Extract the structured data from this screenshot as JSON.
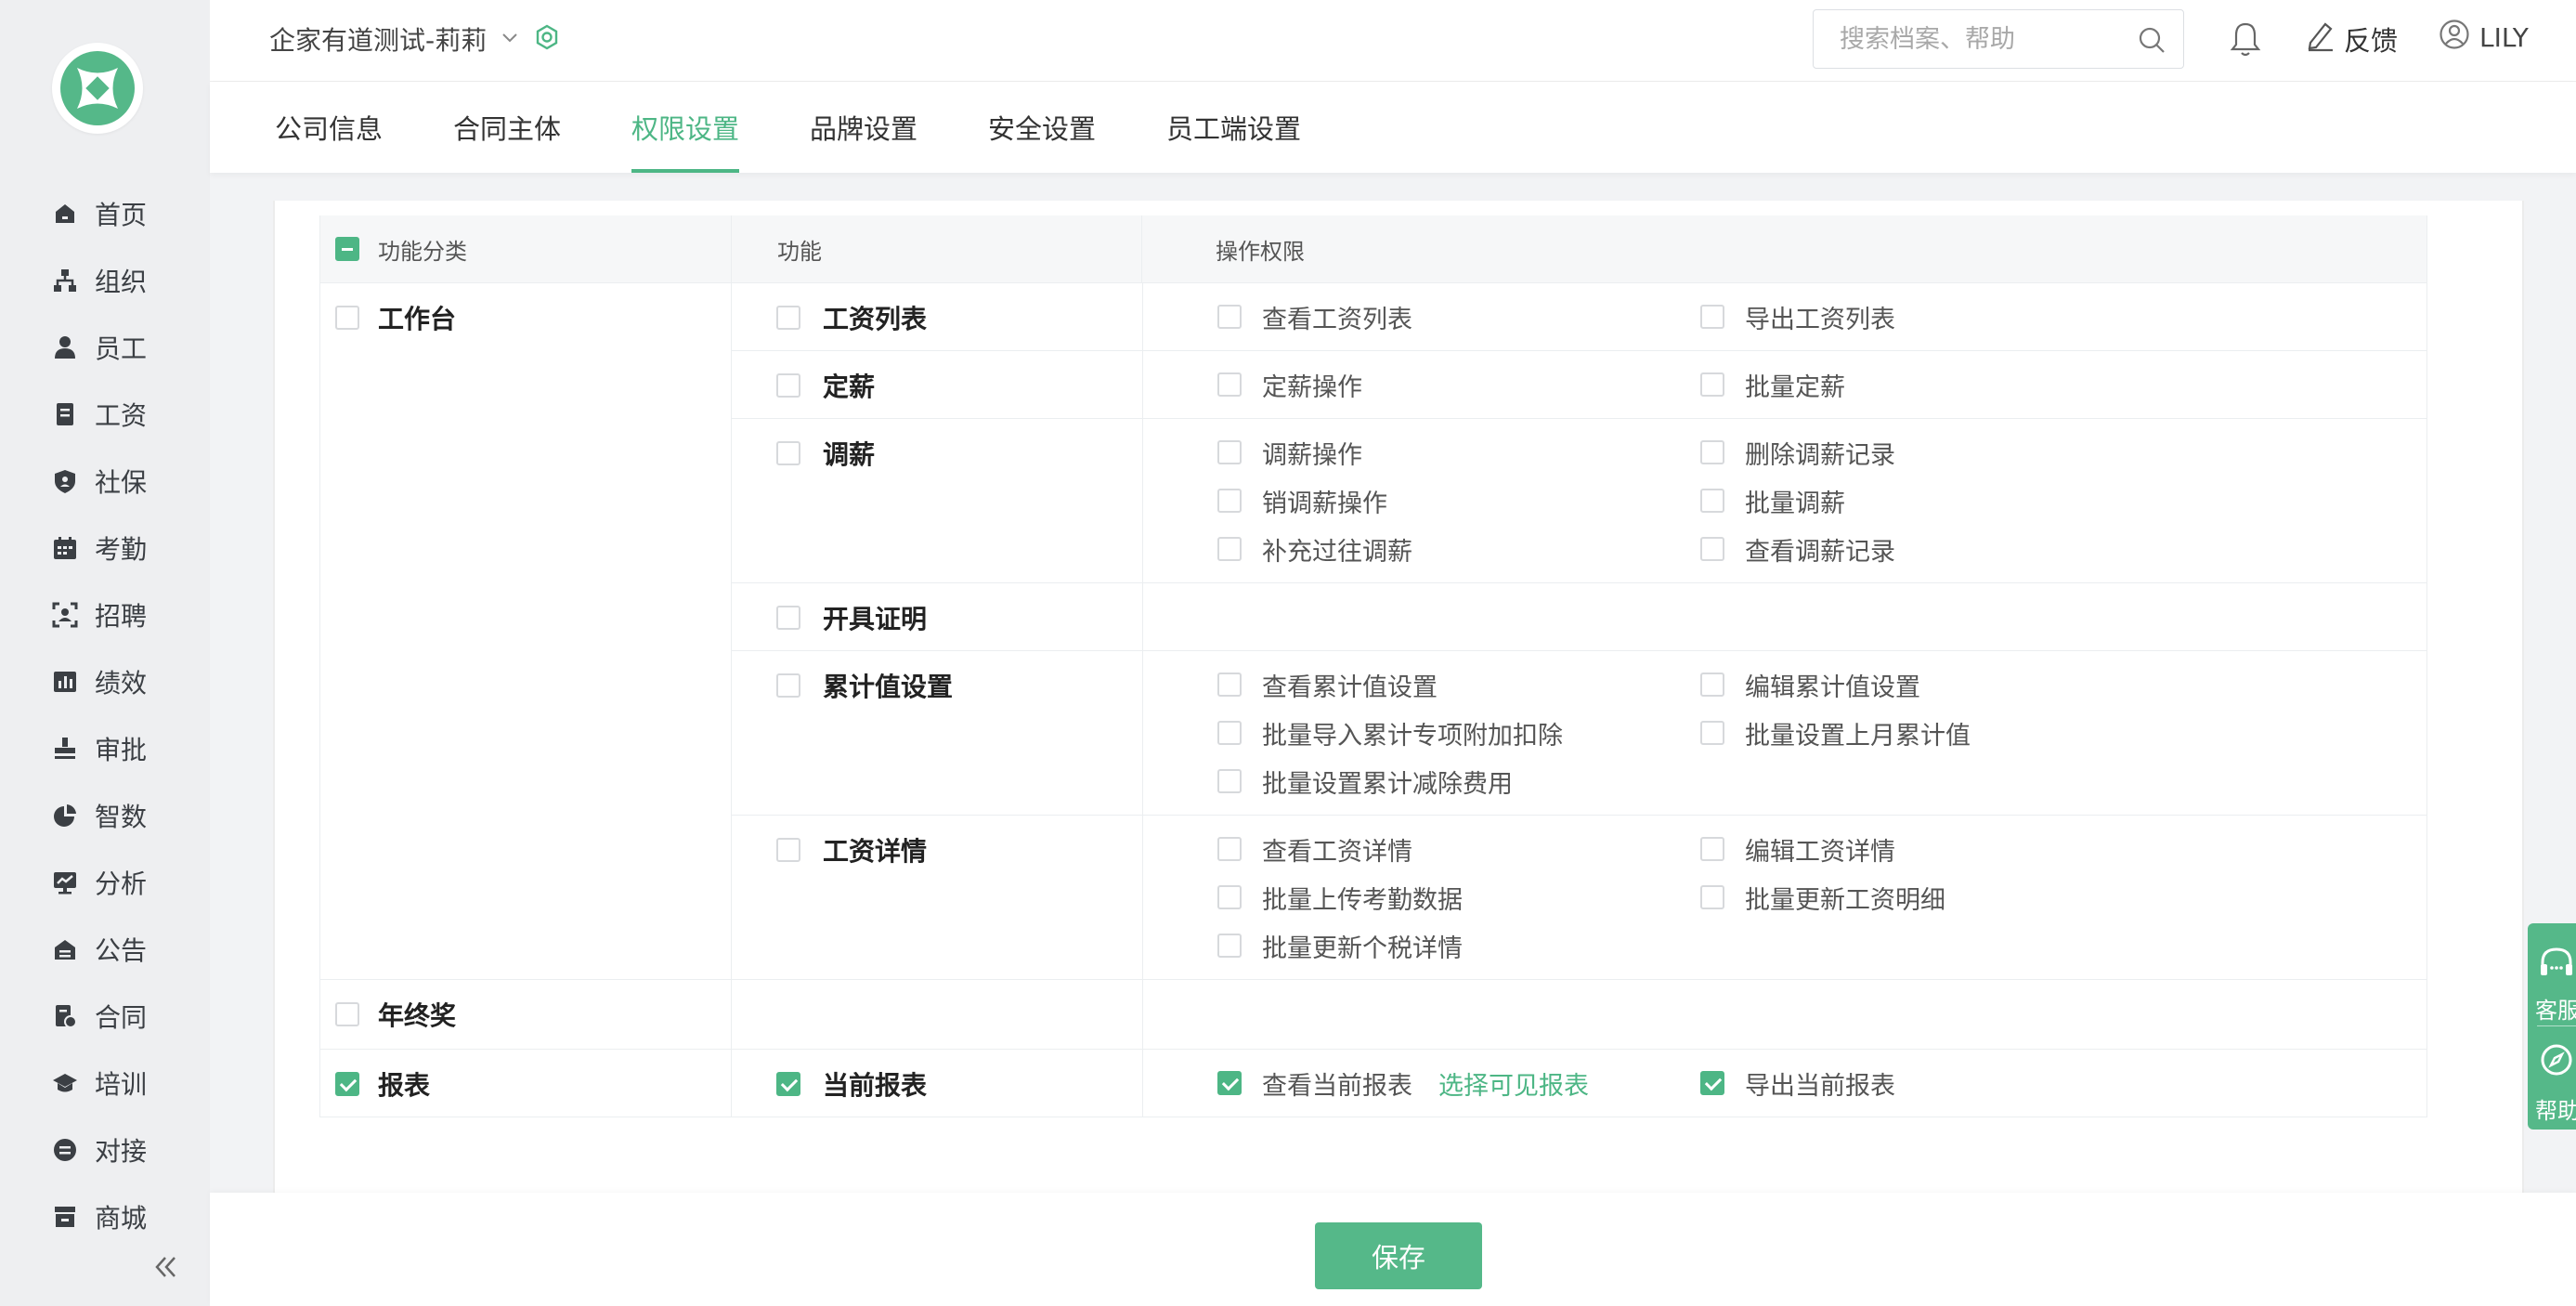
{
  "app": {
    "accent": "#4db685"
  },
  "sidebar": {
    "items": [
      {
        "label": "首页",
        "icon": "home-icon"
      },
      {
        "label": "组织",
        "icon": "org-chart-icon"
      },
      {
        "label": "员工",
        "icon": "person-icon"
      },
      {
        "label": "工资",
        "icon": "salary-icon"
      },
      {
        "label": "社保",
        "icon": "shield-icon"
      },
      {
        "label": "考勤",
        "icon": "calendar-icon"
      },
      {
        "label": "招聘",
        "icon": "scan-person-icon"
      },
      {
        "label": "绩效",
        "icon": "bar-chart-icon"
      },
      {
        "label": "审批",
        "icon": "stamp-icon"
      },
      {
        "label": "智数",
        "icon": "pie-chart-icon"
      },
      {
        "label": "分析",
        "icon": "monitor-chart-icon"
      },
      {
        "label": "公告",
        "icon": "announcement-icon"
      },
      {
        "label": "合同",
        "icon": "contract-icon"
      },
      {
        "label": "培训",
        "icon": "graduation-cap-icon"
      },
      {
        "label": "对接",
        "icon": "link-icon"
      },
      {
        "label": "商城",
        "icon": "store-icon"
      }
    ]
  },
  "header": {
    "company": "企家有道测试-莉莉",
    "search_placeholder": "搜索档案、帮助",
    "feedback": "反馈",
    "user": "LILY"
  },
  "tabs": [
    {
      "label": "公司信息",
      "active": false
    },
    {
      "label": "合同主体",
      "active": false
    },
    {
      "label": "权限设置",
      "active": true
    },
    {
      "label": "品牌设置",
      "active": false
    },
    {
      "label": "安全设置",
      "active": false
    },
    {
      "label": "员工端设置",
      "active": false
    }
  ],
  "table": {
    "headers": {
      "category": "功能分类",
      "function": "功能",
      "operations": "操作权限"
    },
    "workbench": {
      "category": "工作台",
      "functions": [
        {
          "name": "工资列表",
          "ops": [
            "查看工资列表",
            "导出工资列表"
          ]
        },
        {
          "name": "定薪",
          "ops": [
            "定薪操作",
            "批量定薪"
          ]
        },
        {
          "name": "调薪",
          "ops": [
            "调薪操作",
            "删除调薪记录",
            "销调薪操作",
            "批量调薪",
            "补充过往调薪",
            "查看调薪记录"
          ]
        },
        {
          "name": "开具证明",
          "ops": []
        },
        {
          "name": "累计值设置",
          "ops": [
            "查看累计值设置",
            "编辑累计值设置",
            "批量导入累计专项附加扣除",
            "批量设置上月累计值",
            "批量设置累计减除费用"
          ]
        },
        {
          "name": "工资详情",
          "ops": [
            "查看工资详情",
            "编辑工资详情",
            "批量上传考勤数据",
            "批量更新工资明细",
            "批量更新个税详情"
          ]
        }
      ]
    },
    "year_end": {
      "category": "年终奖"
    },
    "report": {
      "category": "报表",
      "function": "当前报表",
      "op1": "查看当前报表",
      "op1_link": "选择可见报表",
      "op2": "导出当前报表"
    }
  },
  "footer": {
    "save": "保存"
  },
  "float_panel": {
    "service": "客服",
    "help": "帮助"
  }
}
